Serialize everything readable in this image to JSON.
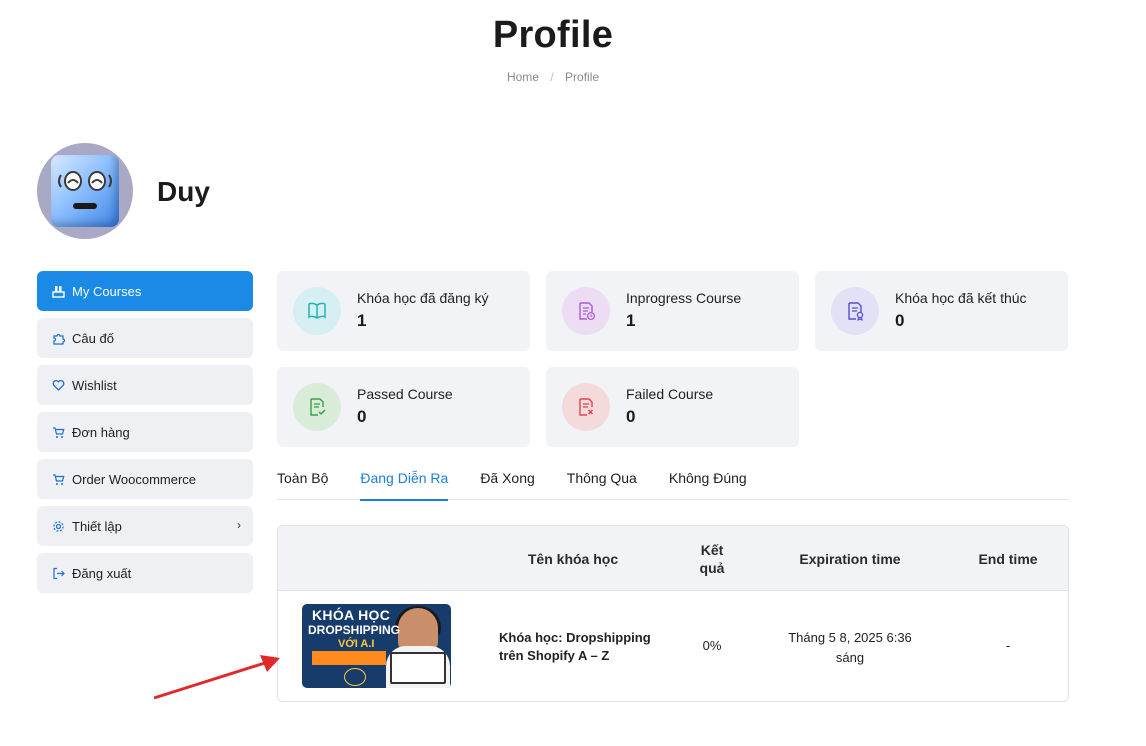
{
  "page": {
    "title": "Profile",
    "breadcrumb": {
      "home": "Home",
      "separator": "/",
      "current": "Profile"
    }
  },
  "user": {
    "name": "Duy"
  },
  "sidebar": {
    "items": [
      {
        "label": "My Courses",
        "icon": "courses-icon",
        "active": true
      },
      {
        "label": "Câu đố",
        "icon": "puzzle-icon"
      },
      {
        "label": "Wishlist",
        "icon": "heart-icon"
      },
      {
        "label": "Đơn hàng",
        "icon": "cart-icon"
      },
      {
        "label": "Order Woocommerce",
        "icon": "cart-icon"
      },
      {
        "label": "Thiết lập",
        "icon": "gear-icon",
        "has_submenu": true
      },
      {
        "label": "Đăng xuất",
        "icon": "logout-icon"
      }
    ]
  },
  "stats": [
    {
      "label": "Khóa học đã đăng ký",
      "value": "1",
      "icon": "book-icon",
      "color": "#1fb5b5"
    },
    {
      "label": "Inprogress Course",
      "value": "1",
      "icon": "progress-doc-icon",
      "color": "#b05ad6"
    },
    {
      "label": "Khóa học đã kết thúc",
      "value": "0",
      "icon": "certificate-doc-icon",
      "color": "#5a4fcf"
    },
    {
      "label": "Passed Course",
      "value": "0",
      "icon": "check-doc-icon",
      "color": "#33a34a"
    },
    {
      "label": "Failed Course",
      "value": "0",
      "icon": "fail-doc-icon",
      "color": "#e0454f"
    }
  ],
  "tabs": [
    {
      "label": "Toàn Bộ",
      "active": false
    },
    {
      "label": "Đang Diễn Ra",
      "active": true
    },
    {
      "label": "Đã Xong",
      "active": false
    },
    {
      "label": "Thông Qua",
      "active": false
    },
    {
      "label": "Không Đúng",
      "active": false
    }
  ],
  "table": {
    "headers": {
      "course_name": "Tên khóa học",
      "result_line1": "Kết",
      "result_line2": "quả",
      "expiration": "Expiration time",
      "end": "End time"
    },
    "rows": [
      {
        "thumbnail": {
          "line1": "KHÓA HỌC",
          "line2": "DROPSHIPPING",
          "line3": "VỚI A.I"
        },
        "course_name_line1": "Khóa học: Dropshipping",
        "course_name_line2": "trên Shopify A – Z",
        "result": "0%",
        "expiration_line1": "Tháng 5 8, 2025 6:36",
        "expiration_line2": "sáng",
        "end_time": "-"
      }
    ]
  },
  "colors": {
    "accent": "#1b8ae6",
    "tab_active": "#1b7fd6",
    "annotation_arrow": "#e02a2a"
  }
}
